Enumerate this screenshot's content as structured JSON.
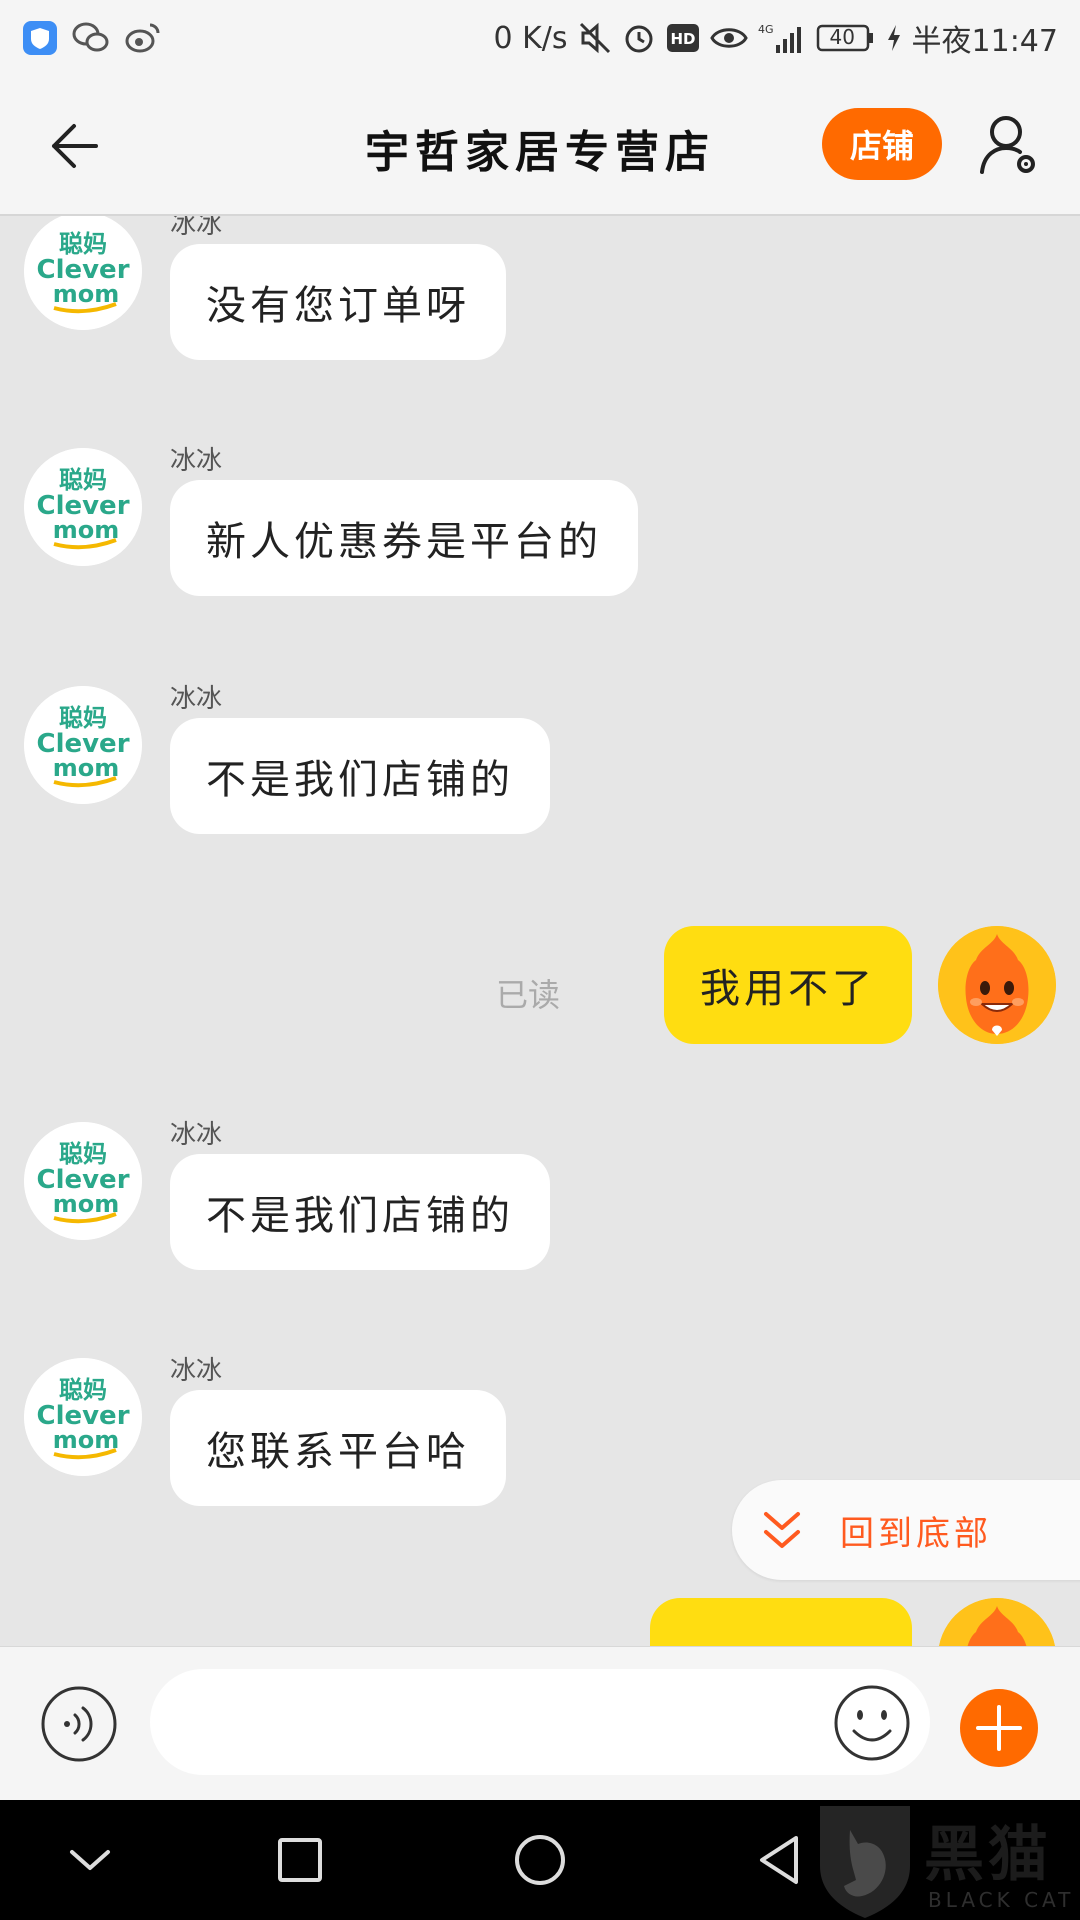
{
  "status_bar": {
    "net_speed": "0 K/s",
    "network": "4G",
    "battery": "40",
    "time": "半夜11:47",
    "hd": "HD"
  },
  "header": {
    "title": "宇哲家居专营店",
    "shop_button": "店铺"
  },
  "shop_avatar": {
    "logo_top": "聪妈",
    "logo_mid": "Clever",
    "logo_bot": "mom"
  },
  "messages": [
    {
      "side": "left",
      "sender": "冰冰",
      "text": "没有您订单呀"
    },
    {
      "side": "left",
      "sender": "冰冰",
      "text": "新人优惠券是平台的"
    },
    {
      "side": "left",
      "sender": "冰冰",
      "text": "不是我们店铺的"
    },
    {
      "side": "right",
      "text": "我用不了",
      "status": "已读"
    },
    {
      "side": "left",
      "sender": "冰冰",
      "text": "不是我们店铺的"
    },
    {
      "side": "left",
      "sender": "冰冰",
      "text": "您联系平台哈"
    }
  ],
  "scroll_to_bottom": "回到底部",
  "input": {
    "placeholder": "",
    "value": ""
  },
  "watermark": {
    "text": "黑猫",
    "sub": "BLACK CAT"
  },
  "colors": {
    "accent": "#ff6a00",
    "user_bubble": "#ffdd11",
    "shop_logo": "#2aa88a"
  }
}
